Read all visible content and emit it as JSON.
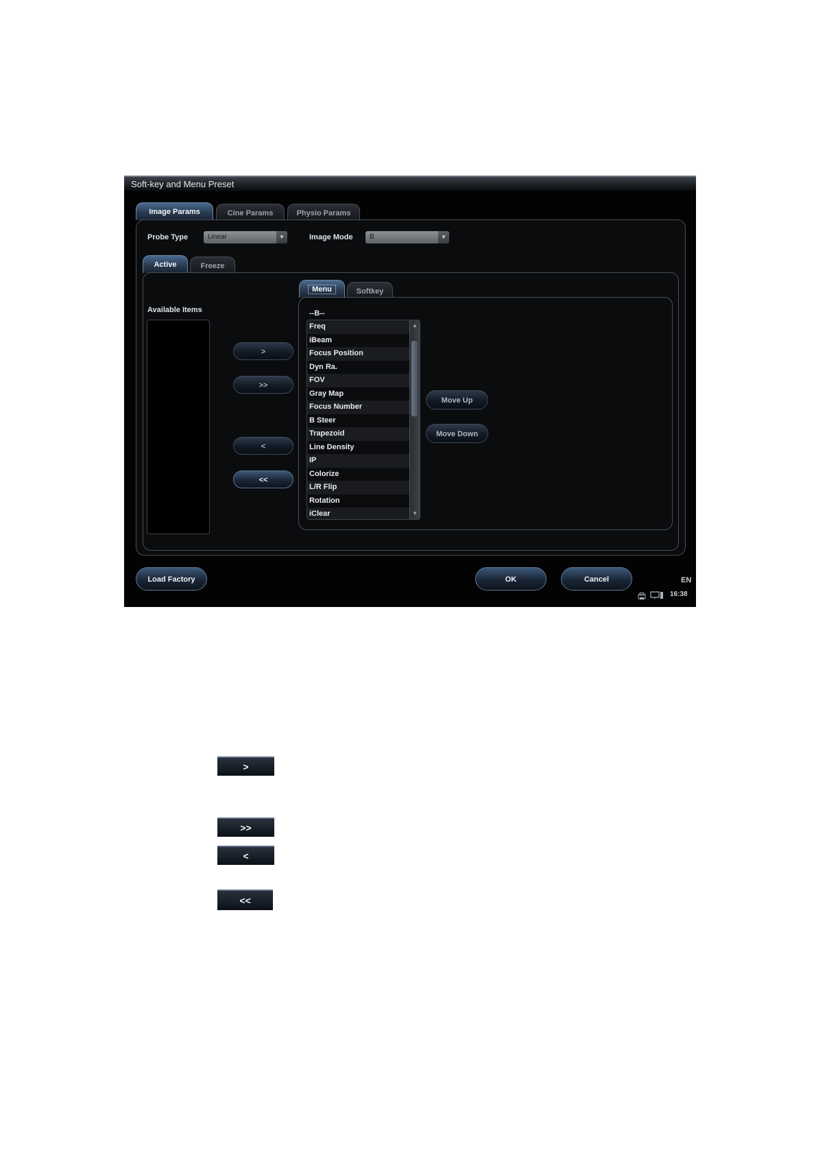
{
  "window": {
    "title": "Soft-key and Menu Preset"
  },
  "main_tabs": [
    {
      "label": "Image Params",
      "active": true
    },
    {
      "label": "Cine Params",
      "active": false
    },
    {
      "label": "Physio Params",
      "active": false
    }
  ],
  "probe_type": {
    "label": "Probe Type",
    "value": "Linear"
  },
  "image_mode": {
    "label": "Image Mode",
    "value": "B"
  },
  "state_tabs": [
    {
      "label": "Active",
      "active": true
    },
    {
      "label": "Freeze",
      "active": false
    }
  ],
  "available": {
    "label": "Available Items"
  },
  "list_tabs": [
    {
      "label": "Menu",
      "active": true
    },
    {
      "label": "Softkey",
      "active": false
    }
  ],
  "menu": {
    "header": "--B--",
    "items": [
      "Freq",
      "iBeam",
      "Focus Position",
      "Dyn Ra.",
      "FOV",
      "Gray Map",
      "Focus Number",
      "B Steer",
      "Trapezoid",
      "Line Density",
      "IP",
      "Colorize",
      "L/R Flip",
      "Rotation",
      "iClear"
    ]
  },
  "transfer_buttons": {
    "add": ">",
    "add_all": ">>",
    "remove": "<",
    "remove_all": "<<"
  },
  "order_buttons": {
    "move_up": "Move Up",
    "move_down": "Move Down"
  },
  "footer": {
    "load_factory": "Load Factory",
    "ok": "OK",
    "cancel": "Cancel",
    "language": "EN",
    "time": "16:38"
  },
  "legend_buttons": [
    ">",
    ">>",
    "<",
    "<<"
  ]
}
